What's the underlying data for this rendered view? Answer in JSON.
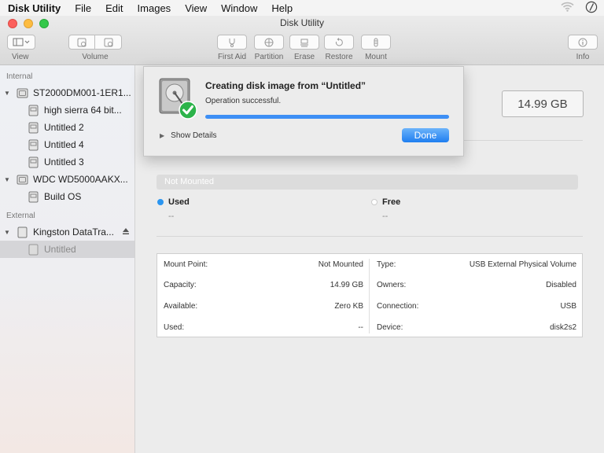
{
  "menubar": {
    "app": "Disk Utility",
    "items": [
      "File",
      "Edit",
      "Images",
      "View",
      "Window",
      "Help"
    ]
  },
  "window": {
    "title": "Disk Utility"
  },
  "toolbar": {
    "view_label": "View",
    "volume_label": "Volume",
    "first_aid_label": "First Aid",
    "partition_label": "Partition",
    "erase_label": "Erase",
    "restore_label": "Restore",
    "mount_label": "Mount",
    "info_label": "Info"
  },
  "sidebar": {
    "internal_header": "Internal",
    "external_header": "External",
    "disk1": {
      "name": "ST2000DM001-1ER1..."
    },
    "disk1_volumes": [
      "high sierra 64 bit...",
      "Untitled 2",
      "Untitled 4",
      "Untitled 3"
    ],
    "disk2": {
      "name": "WDC WD5000AAKX..."
    },
    "disk2_volumes": [
      "Build OS"
    ],
    "ext_disk": {
      "name": "Kingston DataTra..."
    },
    "ext_volumes": [
      "Untitled"
    ]
  },
  "main": {
    "capacity": "14.99 GB",
    "usage_label": "Not Mounted",
    "used_label": "Used",
    "used_value": "--",
    "free_label": "Free",
    "free_value": "--",
    "colors": {
      "used": "#2a95f0",
      "free": "#ffffff"
    }
  },
  "info_table": {
    "left": [
      {
        "label": "Mount Point:",
        "value": "Not Mounted"
      },
      {
        "label": "Capacity:",
        "value": "14.99 GB"
      },
      {
        "label": "Available:",
        "value": "Zero KB"
      },
      {
        "label": "Used:",
        "value": "--"
      }
    ],
    "right": [
      {
        "label": "Type:",
        "value": "USB External Physical Volume"
      },
      {
        "label": "Owners:",
        "value": "Disabled"
      },
      {
        "label": "Connection:",
        "value": "USB"
      },
      {
        "label": "Device:",
        "value": "disk2s2"
      }
    ]
  },
  "sheet": {
    "title": "Creating disk image from “Untitled”",
    "status": "Operation successful.",
    "progress_fraction": 1.0,
    "details_label": "Show Details",
    "done_label": "Done"
  },
  "colors": {
    "accent": "#1f7ef0",
    "close": "#fc605c",
    "minimize": "#fdbc40",
    "zoom": "#34c84a",
    "success": "#2cb34a"
  }
}
